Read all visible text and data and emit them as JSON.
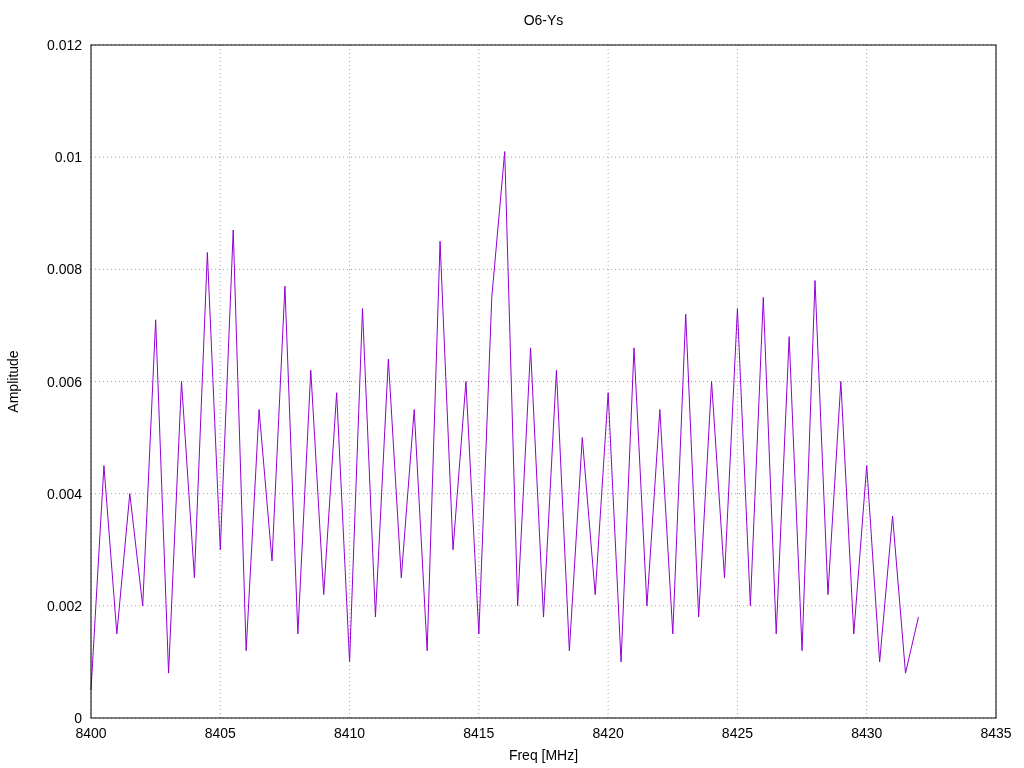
{
  "plot": {
    "chart_data": {
      "type": "line",
      "title": "O6-Ys",
      "xlabel": "Freq [MHz]",
      "ylabel": "Amplitude",
      "x": [
        8400,
        8400.5,
        8401,
        8401.5,
        8402,
        8402.5,
        8403,
        8403.5,
        8404,
        8404.5,
        8405,
        8405.5,
        8406,
        8406.5,
        8407,
        8407.5,
        8408,
        8408.5,
        8409,
        8409.5,
        8410,
        8410.5,
        8411,
        8411.5,
        8412,
        8412.5,
        8413,
        8413.5,
        8414,
        8414.5,
        8415,
        8415.5,
        8416,
        8416.5,
        8417,
        8417.5,
        8418,
        8418.5,
        8419,
        8419.5,
        8420,
        8420.5,
        8421,
        8421.5,
        8422,
        8422.5,
        8423,
        8423.5,
        8424,
        8424.5,
        8425,
        8425.5,
        8426,
        8426.5,
        8427,
        8427.5,
        8428,
        8428.5,
        8429,
        8429.5,
        8430,
        8430.5,
        8431,
        8431.5,
        8432
      ],
      "grid": true,
      "series": [
        {
          "color": "#9400d3",
          "values": [
            0.0005,
            0.0045,
            0.0015,
            0.004,
            0.002,
            0.0071,
            0.0008,
            0.006,
            0.0025,
            0.0083,
            0.003,
            0.0087,
            0.0012,
            0.0055,
            0.0028,
            0.0077,
            0.0015,
            0.0062,
            0.0022,
            0.0058,
            0.001,
            0.0073,
            0.0018,
            0.0064,
            0.0025,
            0.0055,
            0.0012,
            0.0085,
            0.003,
            0.006,
            0.0015,
            0.0075,
            0.0101,
            0.002,
            0.0066,
            0.0018,
            0.0062,
            0.0012,
            0.005,
            0.0022,
            0.0058,
            0.001,
            0.0066,
            0.002,
            0.0055,
            0.0015,
            0.0072,
            0.0018,
            0.006,
            0.0025,
            0.0073,
            0.002,
            0.0075,
            0.0015,
            0.0068,
            0.0012,
            0.0078,
            0.0022,
            0.006,
            0.0015,
            0.0045,
            0.001,
            0.0036,
            0.0008,
            0.0018
          ]
        }
      ],
      "xlim": [
        8400,
        8435
      ],
      "ylim": [
        0,
        0.012
      ],
      "xticks": [
        8400,
        8405,
        8410,
        8415,
        8420,
        8425,
        8430,
        8435
      ],
      "yticks": [
        {
          "value": 0,
          "label": "0"
        },
        {
          "value": 0.002,
          "label": "0.002"
        },
        {
          "value": 0.004,
          "label": "0.004"
        },
        {
          "value": 0.006,
          "label": "0.006"
        },
        {
          "value": 0.008,
          "label": "0.008"
        },
        {
          "value": 0.01,
          "label": "0.01"
        },
        {
          "value": 0.012,
          "label": "0.012"
        }
      ]
    }
  }
}
